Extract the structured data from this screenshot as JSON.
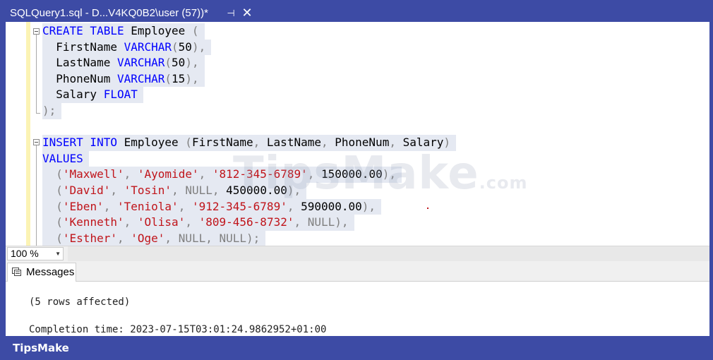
{
  "tab": {
    "title": "SQLQuery1.sql - D...V4KQ0B2\\user (57))*",
    "pin_icon": "⊣",
    "close_icon": "✕"
  },
  "editor": {
    "lines": [
      "CREATE TABLE Employee (",
      "  FirstName VARCHAR(50),",
      "  LastName VARCHAR(50),",
      "  PhoneNum VARCHAR(15),",
      "  Salary FLOAT",
      ");",
      "",
      "INSERT INTO Employee (FirstName, LastName, PhoneNum, Salary)",
      "VALUES",
      "  ('Maxwell', 'Ayomide', '812-345-6789', 150000.00),",
      "  ('David', 'Tosin', NULL, 450000.00),",
      "  ('Eben', 'Teniola', '912-345-6789', 590000.00),",
      "  ('Kenneth', 'Olisa', '809-456-8732', NULL),",
      "  ('Esther', 'Oge', NULL, NULL);"
    ],
    "watermark": "TipsMake",
    "watermark_suffix": ".com"
  },
  "zoom": {
    "value": "100 %",
    "arrow": "▼"
  },
  "results": {
    "tab_label": "Messages",
    "messages": [
      "(5 rows affected)",
      "Completion time: 2023-07-15T03:01:24.9862952+01:00"
    ]
  },
  "brand": "TipsMake",
  "colors": {
    "keyword": "#0000ff",
    "string": "#c0141a",
    "punct": "#808080",
    "frame": "#3d4ba5"
  }
}
